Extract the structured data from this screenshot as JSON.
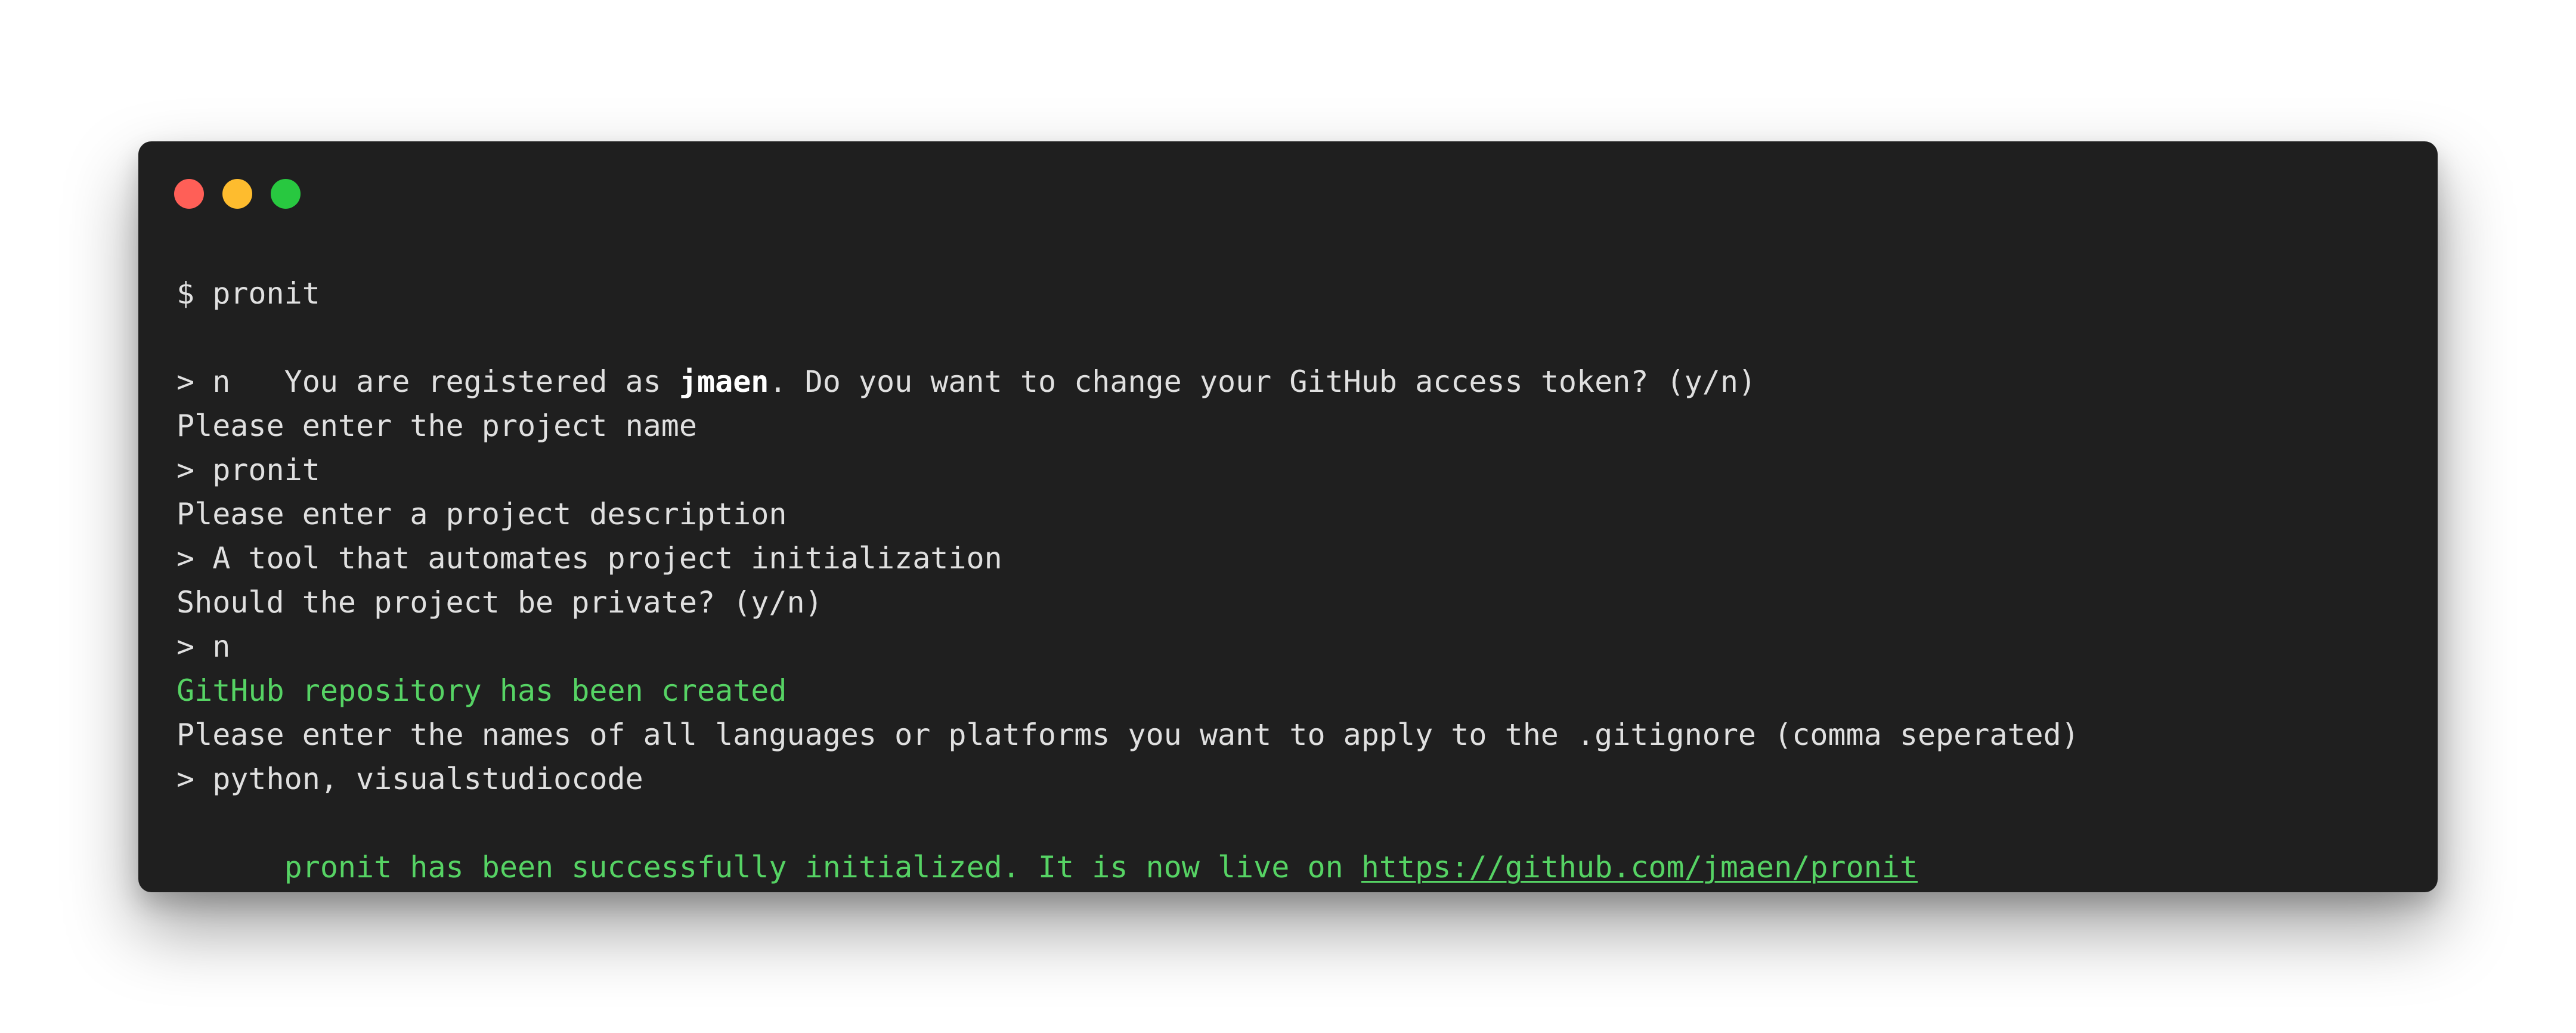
{
  "colors": {
    "background": "#ffffff",
    "terminal_background": "#1f1f1f",
    "text": "#e0e0e0",
    "success": "#56d364",
    "close": "#ff5f57",
    "minimize": "#febc2e",
    "zoom": "#28c840"
  },
  "window_controls": {
    "close": "close-dot",
    "minimize": "minimize-dot",
    "zoom": "zoom-dot"
  },
  "lines": [
    {
      "text": "$ pronit"
    },
    {
      "prefix": "You are registered as ",
      "bold": "jmaen",
      "suffix": ". Do you want to change your GitHub access token? (y/n)"
    },
    {
      "text": "> n"
    },
    {
      "text": "Please enter the project name"
    },
    {
      "text": "> pronit"
    },
    {
      "text": "Please enter a project description"
    },
    {
      "text": "> A tool that automates project initialization"
    },
    {
      "text": "Should the project be private? (y/n)"
    },
    {
      "text": "> n"
    },
    {
      "text": "GitHub repository has been created"
    },
    {
      "text": "Please enter the names of all languages or platforms you want to apply to the .gitignore (comma seperated)"
    },
    {
      "text": "> python, visualstudiocode"
    },
    {
      "prefix": "pronit has been successfully initialized. It is now live on ",
      "link": "https://github.com/jmaen/pronit"
    }
  ]
}
